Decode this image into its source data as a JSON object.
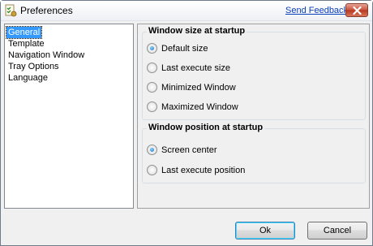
{
  "window": {
    "title": "Preferences",
    "feedback_link": "Send Feedback"
  },
  "nav": {
    "items": [
      {
        "label": "General",
        "selected": true
      },
      {
        "label": "Template"
      },
      {
        "label": "Navigation Window"
      },
      {
        "label": "Tray Options"
      },
      {
        "label": "Language"
      }
    ]
  },
  "size_group": {
    "title": "Window size at startup",
    "options": [
      {
        "label": "Default size",
        "checked": true
      },
      {
        "label": "Last execute size"
      },
      {
        "label": "Minimized Window"
      },
      {
        "label": "Maximized Window"
      }
    ]
  },
  "position_group": {
    "title": "Window position at startup",
    "options": [
      {
        "label": "Screen center",
        "checked": true
      },
      {
        "label": "Last execute position"
      }
    ]
  },
  "buttons": {
    "ok": "Ok",
    "cancel": "Cancel"
  },
  "icons": {
    "app": "preferences-checklist-icon",
    "close": "close-icon"
  }
}
